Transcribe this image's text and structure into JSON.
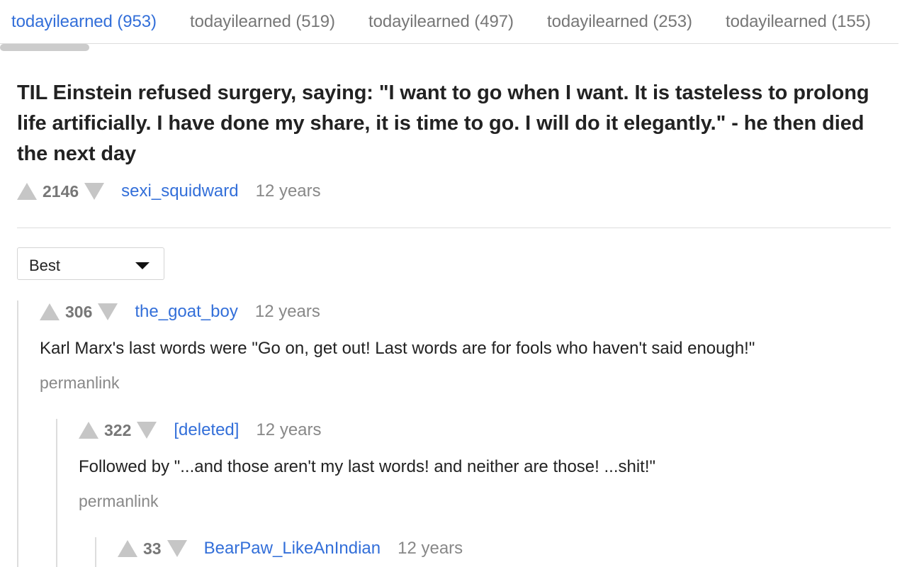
{
  "tabs": [
    {
      "name": "todayilearned",
      "count": "953",
      "active": true
    },
    {
      "name": "todayilearned",
      "count": "519",
      "active": false
    },
    {
      "name": "todayilearned",
      "count": "497",
      "active": false
    },
    {
      "name": "todayilearned",
      "count": "253",
      "active": false
    },
    {
      "name": "todayilearned",
      "count": "155",
      "active": false
    }
  ],
  "post": {
    "title": "TIL Einstein refused surgery, saying: \"I want to go when I want. It is tasteless to prolong life artificially. I have done my share, it is time to go. I will do it elegantly.\" - he then died the next day",
    "score": "2146",
    "author": "sexi_squidward",
    "age": "12 years"
  },
  "sort": {
    "selected": "Best"
  },
  "comments": [
    {
      "score": "306",
      "author": "the_goat_boy",
      "age": "12 years",
      "body": "Karl Marx's last words were \"Go on, get out! Last words are for fools who haven't said enough!\"",
      "permalink": "permanlink"
    },
    {
      "score": "322",
      "author": "[deleted]",
      "age": "12 years",
      "body": "Followed by \"...and those aren't my last words! and neither are those! ...shit!\"",
      "permalink": "permanlink"
    },
    {
      "score": "33",
      "author": "BearPaw_LikeAnIndian",
      "age": "12 years"
    }
  ],
  "colors": {
    "accent": "#336fd9",
    "muted": "#888888",
    "arrow": "#c6c6c6"
  },
  "icons": {
    "upvote": "upvote-arrow-icon",
    "downvote": "downvote-arrow-icon",
    "dropdown": "caret-down-icon"
  }
}
